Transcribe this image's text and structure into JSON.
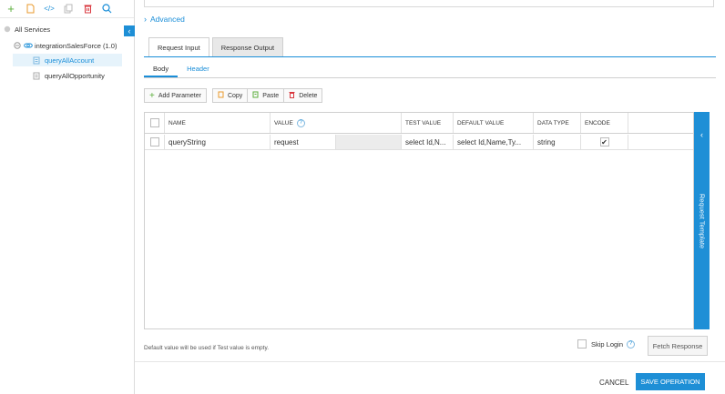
{
  "sidebar": {
    "root_label": "All Services",
    "service_label": "integrationSalesForce (1.0)",
    "operations": [
      "queryAllAccount",
      "queryAllOpportunity"
    ],
    "selected_operation": "queryAllAccount"
  },
  "main": {
    "advanced_label": "Advanced",
    "tabs": [
      "Request Input",
      "Response Output"
    ],
    "subtabs": [
      "Body",
      "Header"
    ],
    "actions": {
      "add_parameter": "Add Parameter",
      "copy": "Copy",
      "paste": "Paste",
      "delete": "Delete"
    },
    "grid": {
      "headers": [
        "NAME",
        "VALUE",
        "TEST VALUE",
        "DEFAULT VALUE",
        "DATA TYPE",
        "ENCODE"
      ],
      "row": {
        "name": "queryString",
        "value": "request",
        "test_value": "select Id,N...",
        "default_value": "select Id,Name,Ty...",
        "data_type": "string",
        "encode": true
      }
    },
    "request_template_label": "Request Template",
    "hint": "Default value will be used if Test value is empty.",
    "skip_login_label": "Skip Login",
    "fetch_response_label": "Fetch Response",
    "cancel_label": "CANCEL",
    "save_label": "SAVE OPERATION"
  },
  "colors": {
    "accent": "#1e8fd6",
    "delete": "#d9383f",
    "paste": "#5aae3a",
    "copy": "#e99a2c"
  }
}
